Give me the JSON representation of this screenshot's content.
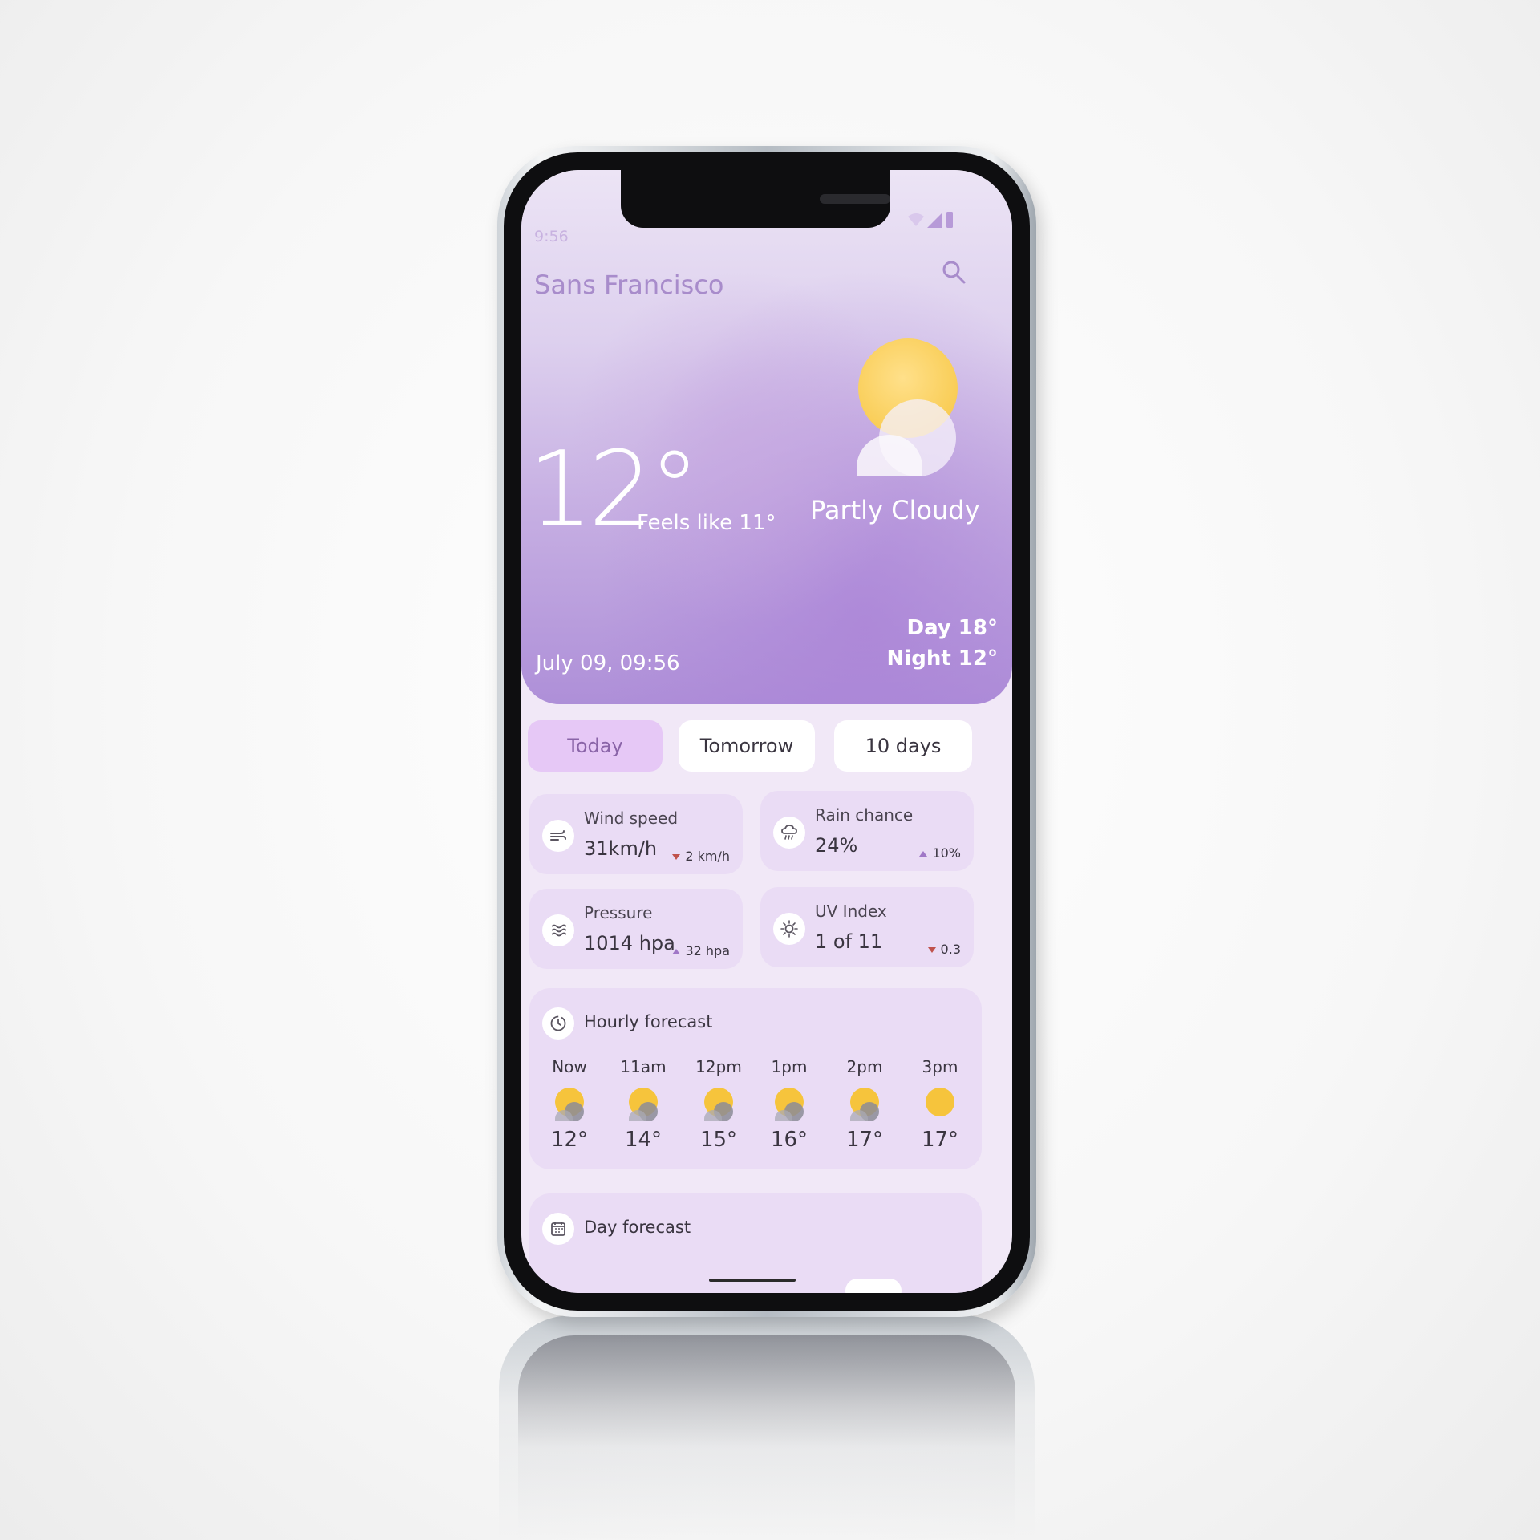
{
  "status": {
    "time": "9:56"
  },
  "header": {
    "city": "Sans Francisco"
  },
  "current": {
    "temperature": "12°",
    "feels_like": "Feels like 11°",
    "condition": "Partly Cloudy",
    "day": "Day 18°",
    "night": "Night 12°",
    "date": "July 09, 09:56"
  },
  "tabs": [
    {
      "label": "Today",
      "selected": true
    },
    {
      "label": "Tomorrow",
      "selected": false
    },
    {
      "label": "10 days",
      "selected": false
    }
  ],
  "metrics": [
    {
      "label": "Wind speed",
      "value": "31km/h",
      "delta": "2 km/h",
      "trend": "down",
      "icon": "wind-icon"
    },
    {
      "label": "Rain chance",
      "value": "24%",
      "delta": "10%",
      "trend": "up",
      "icon": "rain-icon"
    },
    {
      "label": "Pressure",
      "value": "1014 hpa",
      "delta": "32 hpa",
      "trend": "up",
      "icon": "waves-icon"
    },
    {
      "label": "UV Index",
      "value": "1 of 11",
      "delta": "0.3",
      "trend": "down",
      "icon": "sun-icon"
    }
  ],
  "hourly": {
    "title": "Hourly forecast",
    "icon": "clock-icon",
    "items": [
      {
        "time": "Now",
        "temp": "12°",
        "condition": "partly-cloudy"
      },
      {
        "time": "11am",
        "temp": "14°",
        "condition": "partly-cloudy"
      },
      {
        "time": "12pm",
        "temp": "15°",
        "condition": "partly-cloudy"
      },
      {
        "time": "1pm",
        "temp": "16°",
        "condition": "partly-cloudy"
      },
      {
        "time": "2pm",
        "temp": "17°",
        "condition": "partly-cloudy"
      },
      {
        "time": "3pm",
        "temp": "17°",
        "condition": "sunny"
      }
    ]
  },
  "day_forecast": {
    "title": "Day forecast",
    "icon": "calendar-icon"
  },
  "colors": {
    "accent": "#a88ccb",
    "tab_selected": "#e6c8f6",
    "card_bg": "#eadcf5",
    "sun": "#f6c43c",
    "trend_down": "#c0524c",
    "trend_up": "#a077c7"
  }
}
